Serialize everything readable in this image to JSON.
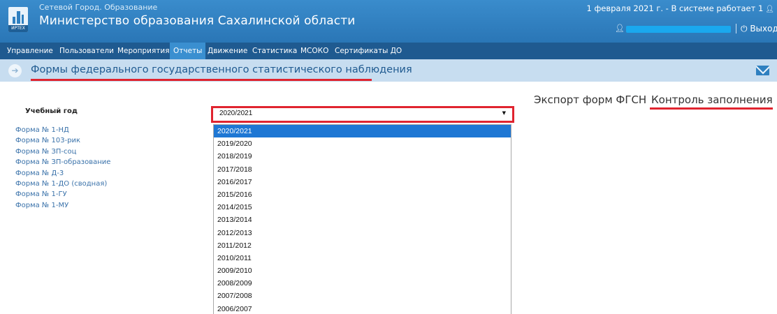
{
  "header": {
    "system_name": "Сетевой Город. Образование",
    "org_name": "Министерство образования Сахалинской области",
    "logo_text": "ИРТЕХ",
    "status": "1 февраля 2021 г. - В системе работает 1",
    "logout": "Выход"
  },
  "nav": {
    "items": [
      {
        "label": "Управление"
      },
      {
        "label": "Пользователи"
      },
      {
        "label": "Мероприятия"
      },
      {
        "label": "Отчеты"
      },
      {
        "label": "Движение"
      },
      {
        "label": "Статистика"
      },
      {
        "label": "МСОКО"
      },
      {
        "label": "Сертификаты ДО"
      }
    ],
    "active": "Отчеты"
  },
  "page": {
    "title": "Формы федерального государственного статистического наблюдения"
  },
  "links": {
    "export": "Экспорт форм ФГСН",
    "control": "Контроль заполнения"
  },
  "year_label": "Учебный год",
  "forms": [
    "Форма № 1-НД",
    "Форма № 103-рик",
    "Форма № ЗП-соц",
    "Форма № ЗП-образование",
    "Форма № Д-3",
    "Форма № 1-ДО (сводная)",
    "Форма № 1-ГУ",
    "Форма № 1-МУ"
  ],
  "year_select": {
    "value": "2020/2021",
    "options": [
      "2020/2021",
      "2019/2020",
      "2018/2019",
      "2017/2018",
      "2016/2017",
      "2015/2016",
      "2014/2015",
      "2013/2014",
      "2012/2013",
      "2011/2012",
      "2010/2011",
      "2009/2010",
      "2008/2009",
      "2007/2008",
      "2006/2007"
    ]
  },
  "colors": {
    "header": "#2f80c0",
    "nav": "#1f5a90",
    "title_bar": "#c7ddf0",
    "highlight": "#e0242f",
    "selected_option": "#1e77d4"
  }
}
